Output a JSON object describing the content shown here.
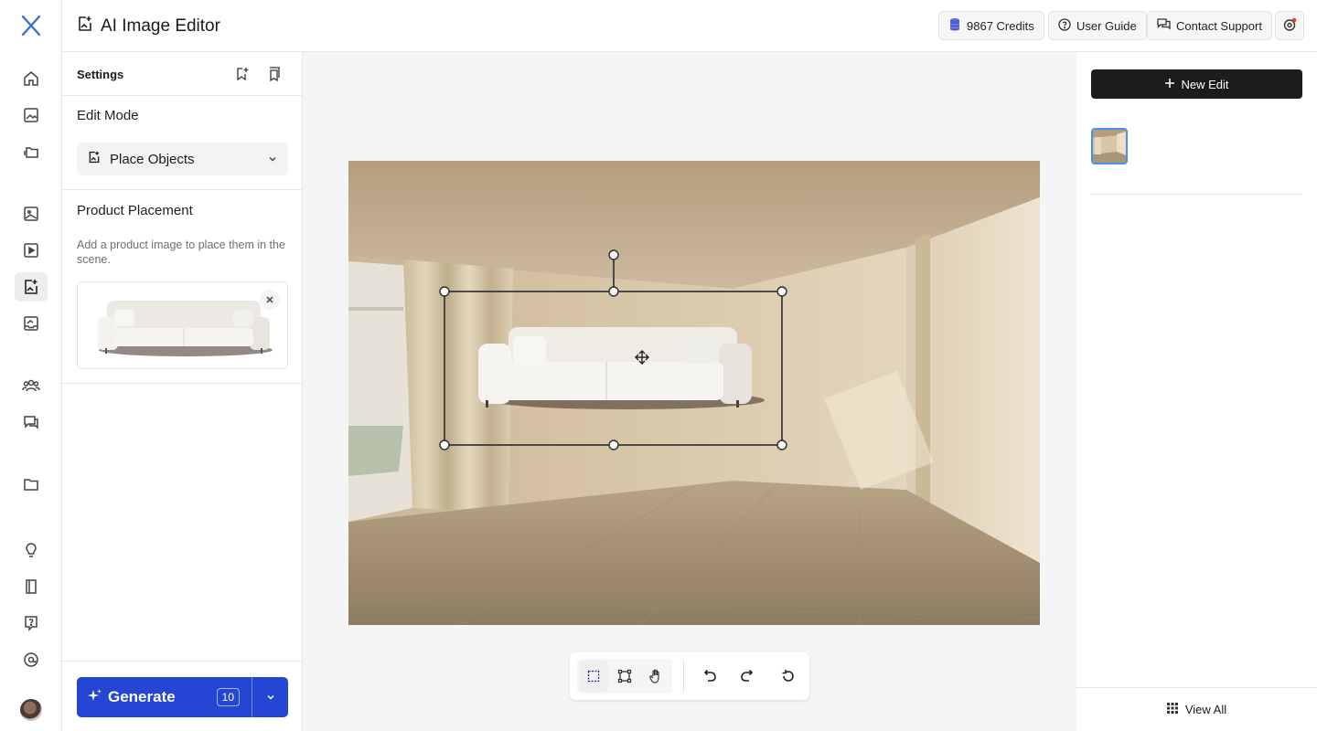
{
  "app": {
    "logo": "X",
    "title": "AI Image Editor"
  },
  "header": {
    "credits_label": "9867 Credits",
    "user_guide_label": "User Guide",
    "contact_support_label": "Contact Support"
  },
  "rail": {
    "icons": [
      "home-icon",
      "image-gallery-icon",
      "folders-icon",
      "image-icon",
      "video-icon",
      "image-edit-icon",
      "inbox-image-icon",
      "team-icon",
      "chat-icon",
      "folder-icon",
      "lightbulb-icon",
      "book-icon",
      "help-icon",
      "at-sign-icon",
      "avatar"
    ],
    "active": "image-edit-icon"
  },
  "settings": {
    "header_label": "Settings",
    "edit_mode_title": "Edit Mode",
    "edit_mode_value": "Place Objects",
    "product_placement_title": "Product Placement",
    "product_placement_desc": "Add a product image to place them in the scene.",
    "generate_label": "Generate",
    "generate_count": "10"
  },
  "right_panel": {
    "new_edit_label": "New Edit",
    "view_all_label": "View All"
  },
  "toolbar": {
    "tools": [
      "select-tool-icon",
      "transform-tool-icon",
      "pan-tool-icon"
    ],
    "actions": [
      "undo-icon",
      "redo-icon",
      "reset-icon"
    ],
    "active_tool": "select-tool-icon"
  },
  "colors": {
    "accent_blue": "#2546d4",
    "dark_button": "#1c1c1c",
    "selection_border": "#4c8ee8"
  }
}
